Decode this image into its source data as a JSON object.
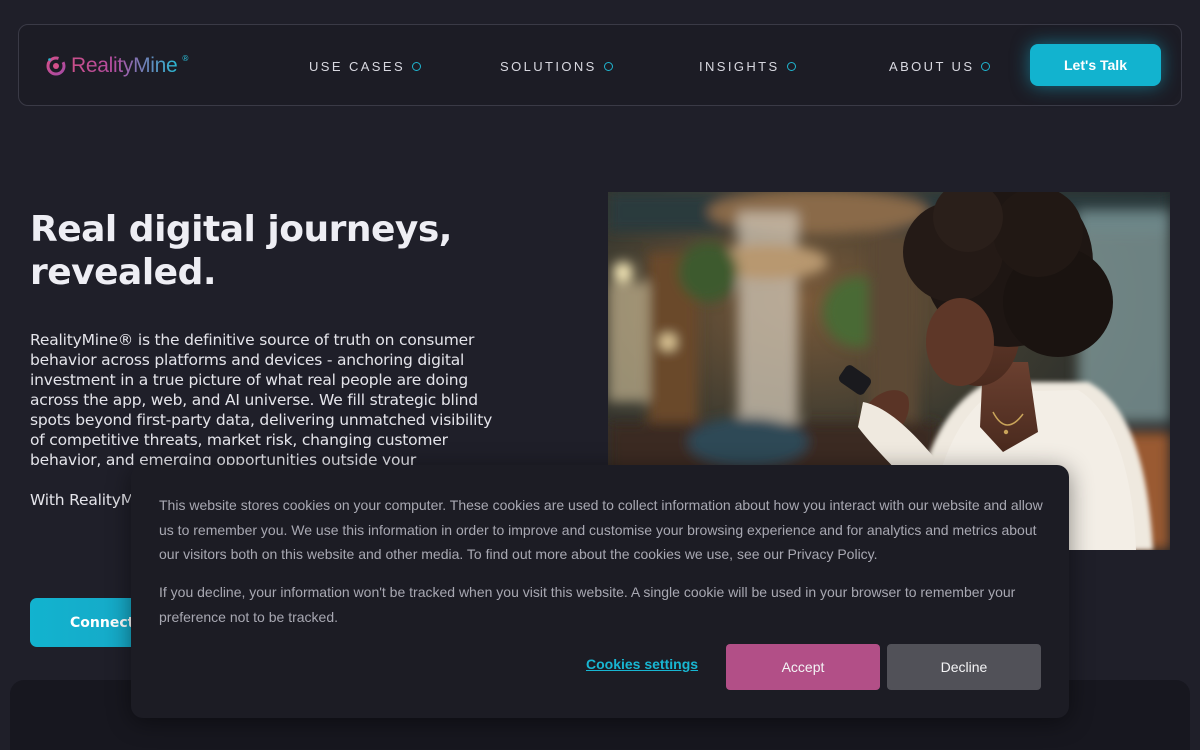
{
  "brand": {
    "name": "RealityMine",
    "registered_mark": "®",
    "logo_icon": "realitymine-logo-icon"
  },
  "nav": {
    "items": [
      {
        "label": "USE CASES",
        "icon": "circle-dot-icon"
      },
      {
        "label": "SOLUTIONS",
        "icon": "circle-dot-icon"
      },
      {
        "label": "INSIGHTS",
        "icon": "circle-dot-icon"
      },
      {
        "label": "ABOUT US",
        "icon": "circle-dot-icon"
      }
    ],
    "cta_label": "Let's Talk"
  },
  "hero": {
    "title_line1": "Real digital journeys,",
    "title_line2": "revealed.",
    "body": "RealityMine® is the definitive source of truth on consumer behavior across platforms and devices - anchoring digital investment in a true picture of what real people are doing across the app, web, and AI universe. We fill strategic blind spots beyond first-party data, delivering unmatched visibility of competitive threats, market risk, changing customer behavior, and emerging opportunities outside your ecosystem.",
    "body2": "With RealityMine, confidently align your strategy, and",
    "button_label": "Connect to",
    "image_description": "woman-using-phone-photo"
  },
  "cookie_banner": {
    "paragraph1": "This website stores cookies on your computer. These cookies are used to collect information about how you interact with our website and allow us to remember you. We use this information in order to improve and customise your browsing experience and for analytics and metrics about our visitors both on this website and other media. To find out more about the cookies we use, see our Privacy Policy.",
    "paragraph2": "If you decline, your information won't be tracked when you visit this website. A single cookie will be used in your browser to remember your preference not to be tracked.",
    "settings_label": "Cookies settings",
    "accept_label": "Accept",
    "decline_label": "Decline"
  },
  "colors": {
    "background": "#1f1f29",
    "accent_cyan": "#12b3cf",
    "accent_pink": "#b24f87",
    "decline_gray": "#515158"
  }
}
